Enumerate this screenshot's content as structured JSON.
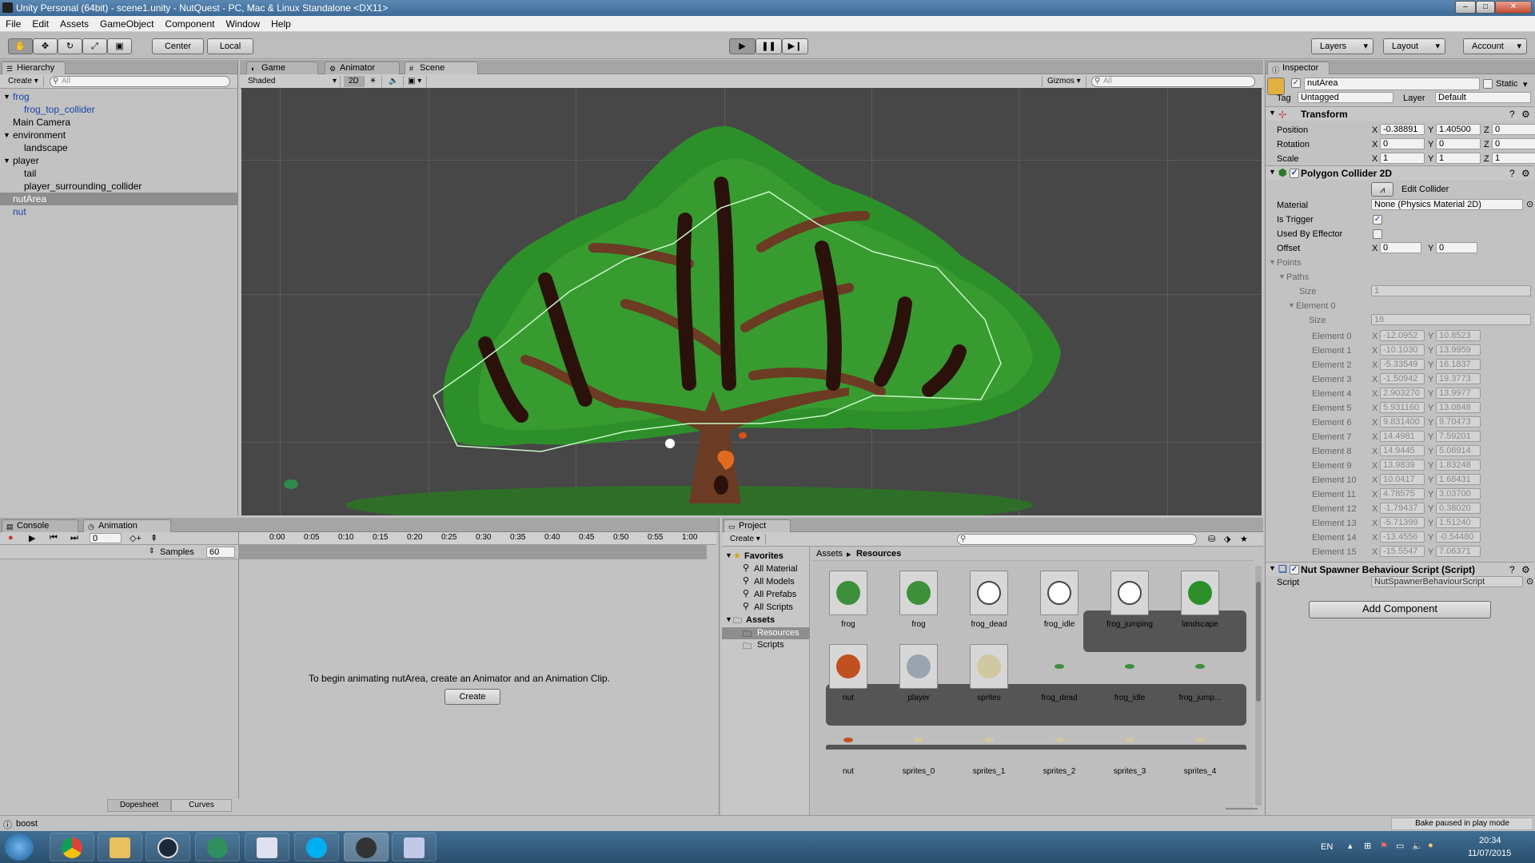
{
  "window": {
    "title": "Unity Personal (64bit) - scene1.unity - NutQuest - PC, Mac & Linux Standalone <DX11>"
  },
  "menu": [
    "File",
    "Edit",
    "Assets",
    "GameObject",
    "Component",
    "Window",
    "Help"
  ],
  "toolbar": {
    "center": "Center",
    "local": "Local",
    "layers": "Layers",
    "layout": "Layout",
    "account": "Account"
  },
  "hierarchy": {
    "tab": "Hierarchy",
    "create": "Create",
    "search_placeholder": "All",
    "items": [
      {
        "label": "frog",
        "blue": true,
        "arrow": "▼",
        "indent": 0
      },
      {
        "label": "frog_top_collider",
        "blue": true,
        "indent": 1
      },
      {
        "label": "Main Camera",
        "indent": 0
      },
      {
        "label": "environment",
        "arrow": "▼",
        "indent": 0
      },
      {
        "label": "landscape",
        "indent": 1
      },
      {
        "label": "player",
        "arrow": "▼",
        "indent": 0
      },
      {
        "label": "tail",
        "indent": 1
      },
      {
        "label": "player_surrounding_collider",
        "indent": 1
      },
      {
        "label": "nutArea",
        "selected": true,
        "indent": 0
      },
      {
        "label": "nut",
        "blue": true,
        "indent": 0
      }
    ]
  },
  "scene_tabs": {
    "game": "Game",
    "animator": "Animator",
    "scene": "Scene",
    "shaded": "Shaded",
    "mode2d": "2D",
    "gizmos": "Gizmos",
    "search_placeholder": "All"
  },
  "inspector": {
    "tab": "Inspector",
    "name": "nutArea",
    "static": "Static",
    "tag_label": "Tag",
    "tag": "Untagged",
    "layer_label": "Layer",
    "layer": "Default",
    "transform": {
      "title": "Transform",
      "position": {
        "label": "Position",
        "x": "-0.38891",
        "y": "1.40500",
        "z": "0"
      },
      "rotation": {
        "label": "Rotation",
        "x": "0",
        "y": "0",
        "z": "0"
      },
      "scale": {
        "label": "Scale",
        "x": "1",
        "y": "1",
        "z": "1"
      }
    },
    "collider": {
      "title": "Polygon Collider 2D",
      "edit": "Edit Collider",
      "material_label": "Material",
      "material": "None (Physics Material 2D)",
      "trigger_label": "Is Trigger",
      "is_trigger": true,
      "effector_label": "Used By Effector",
      "used_by_effector": false,
      "offset_label": "Offset",
      "offset_x": "0",
      "offset_y": "0",
      "points": "Points",
      "paths": "Paths",
      "size_label": "Size",
      "paths_size": "1",
      "element0": "Element 0",
      "element_size": "16",
      "elements": [
        {
          "name": "Element 0",
          "x": "-12.0952",
          "y": "10.8523"
        },
        {
          "name": "Element 1",
          "x": "-10.1030",
          "y": "13.9959"
        },
        {
          "name": "Element 2",
          "x": "-5.33549",
          "y": "16.1837"
        },
        {
          "name": "Element 3",
          "x": "-1.50942",
          "y": "19.3773"
        },
        {
          "name": "Element 4",
          "x": "2.903270",
          "y": "13.9977"
        },
        {
          "name": "Element 5",
          "x": "5.931160",
          "y": "13.0848"
        },
        {
          "name": "Element 6",
          "x": "9.831400",
          "y": "9.70473"
        },
        {
          "name": "Element 7",
          "x": "14.4981",
          "y": "7.59201"
        },
        {
          "name": "Element 8",
          "x": "14.9445",
          "y": "5.08914"
        },
        {
          "name": "Element 9",
          "x": "13.9839",
          "y": "1.83248"
        },
        {
          "name": "Element 10",
          "x": "10.0417",
          "y": "1.68431"
        },
        {
          "name": "Element 11",
          "x": "4.78575",
          "y": "3.03700"
        },
        {
          "name": "Element 12",
          "x": "-1.79437",
          "y": "0.38020"
        },
        {
          "name": "Element 13",
          "x": "-5.71399",
          "y": "1.51240"
        },
        {
          "name": "Element 14",
          "x": "-13.4556",
          "y": "-0.54480"
        },
        {
          "name": "Element 15",
          "x": "-15.5547",
          "y": "7.06371"
        }
      ]
    },
    "script": {
      "title": "Nut Spawner Behaviour Script (Script)",
      "label": "Script",
      "value": "NutSpawnerBehaviourScript"
    },
    "add_component": "Add Component"
  },
  "bottom_left": {
    "console": "Console",
    "animation": "Animation",
    "samples_label": "Samples",
    "samples": "60",
    "frame": "0",
    "timeline": [
      "0:00",
      "0:05",
      "0:10",
      "0:15",
      "0:20",
      "0:25",
      "0:30",
      "0:35",
      "0:40",
      "0:45",
      "0:50",
      "0:55",
      "1:00"
    ],
    "message": "To begin animating nutArea, create an Animator and an Animation Clip.",
    "create": "Create",
    "dopesheet": "Dopesheet",
    "curves": "Curves"
  },
  "project": {
    "tab": "Project",
    "create": "Create",
    "favorites": "Favorites",
    "fav_items": [
      "All Material",
      "All Models",
      "All Prefabs",
      "All Scripts"
    ],
    "assets": "Assets",
    "folders": [
      "Resources",
      "Scripts"
    ],
    "breadcrumb": [
      "Assets",
      "Resources"
    ],
    "row1": [
      "frog",
      "frog",
      "frog_dead",
      "frog_idle",
      "frog_jumping",
      "landscape"
    ],
    "row2": [
      "nut",
      "player",
      "sprites",
      "frog_dead",
      "frog_idle",
      "frog_jump..."
    ],
    "row3": [
      "nut",
      "sprites_0",
      "sprites_1",
      "sprites_2",
      "sprites_3",
      "sprites_4"
    ]
  },
  "status": {
    "left": "boost",
    "right": "Bake paused in play mode"
  },
  "taskbar": {
    "lang": "EN",
    "time": "20:34",
    "date": "11/07/2015"
  }
}
